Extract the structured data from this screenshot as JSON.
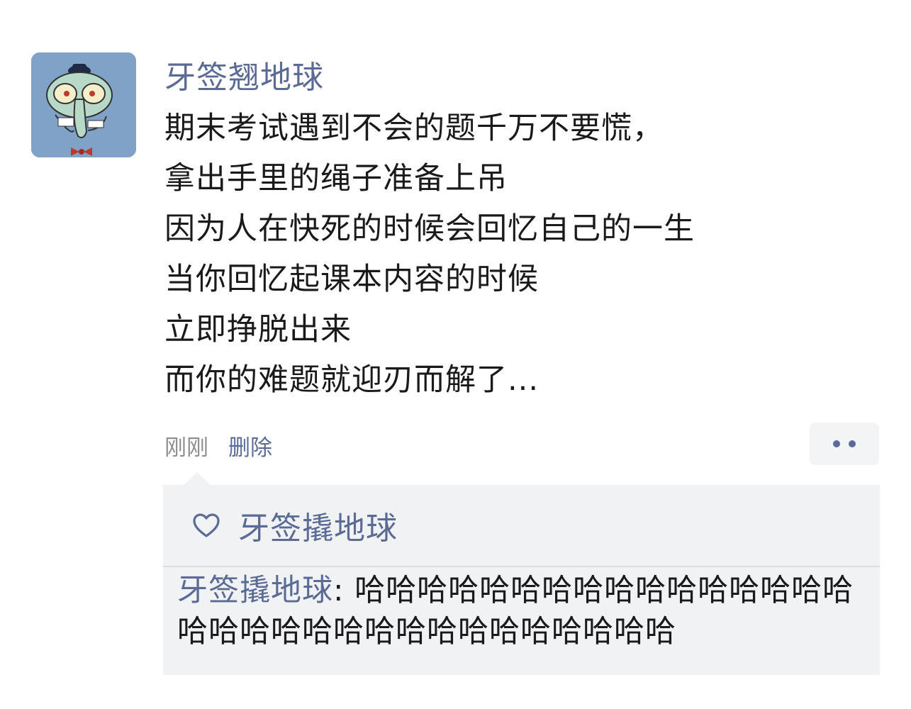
{
  "post": {
    "username": "牙签翘地球",
    "lines": [
      "期末考试遇到不会的题千万不要慌，",
      "拿出手里的绳子准备上吊",
      "因为人在快死的时候会回忆自己的一生",
      "当你回忆起课本内容的时候",
      "立即挣脱出来",
      "而你的难题就迎刃而解了..."
    ],
    "time": "刚刚",
    "delete_label": "删除"
  },
  "likes": {
    "icon": "heart-icon",
    "names": "牙签撬地球"
  },
  "comment": {
    "author": "牙签撬地球",
    "separator": ": ",
    "text": "哈哈哈哈哈哈哈哈哈哈哈哈哈哈哈哈哈哈哈哈哈哈哈哈哈哈哈哈哈哈哈哈"
  },
  "colors": {
    "link": "#5b6b95",
    "panel_bg": "#f1f2f4",
    "text": "#1a1a1a",
    "muted": "#8e8e8e"
  }
}
